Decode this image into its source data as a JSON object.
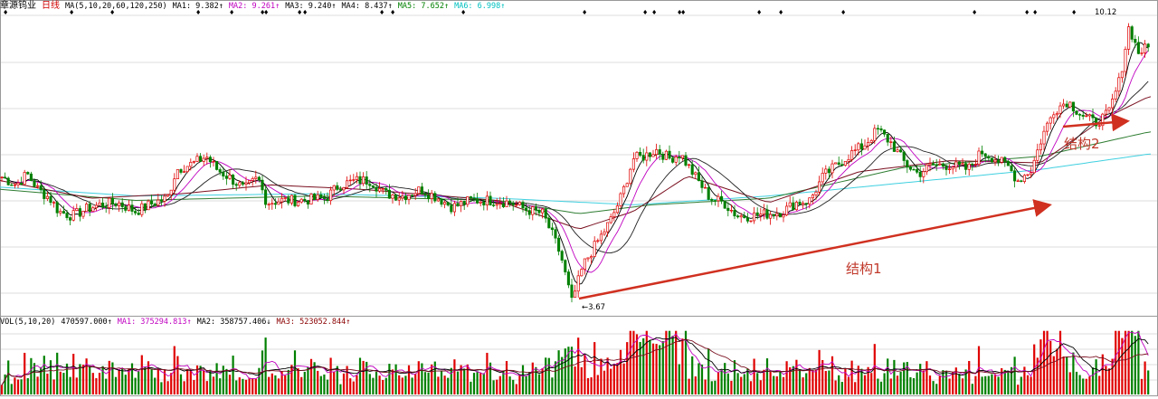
{
  "stock": {
    "name": "章源钨业",
    "period": "日线"
  },
  "price_legend": [
    {
      "text": "MA(5,10,20,60,120,250)",
      "color": "#000000"
    },
    {
      "text": "MA1: 9.382↑",
      "color": "#000000"
    },
    {
      "text": "MA2: 9.261↑",
      "color": "#c000c0"
    },
    {
      "text": "MA3: 9.240↑",
      "color": "#000000"
    },
    {
      "text": "MA4: 8.437↑",
      "color": "#000000"
    },
    {
      "text": "MA5: 7.652↑",
      "color": "#008000"
    },
    {
      "text": "MA6: 6.998↑",
      "color": "#00c0c0"
    }
  ],
  "volume_legend": [
    {
      "text": "VOL(5,10,20)",
      "color": "#000000"
    },
    {
      "text": "470597.000↑",
      "color": "#000000"
    },
    {
      "text": "MA1: 375294.813↑",
      "color": "#c000c0"
    },
    {
      "text": "MA2: 358757.406↓",
      "color": "#000000"
    },
    {
      "text": "MA3: 523052.844↑",
      "color": "#8b0000"
    }
  ],
  "annotations": {
    "structure1": "结构1",
    "structure2": "结构2",
    "high_label": "10.12",
    "low_label": "3.67"
  },
  "colors": {
    "up": "#e00000",
    "down": "#008000",
    "arrow": "#d03020",
    "grid": "#dcdcdc",
    "ma1": "#000000",
    "ma2": "#c000c0",
    "ma3": "#202020",
    "ma4": "#7a1020",
    "ma5": "#2e7d32",
    "ma6": "#40d0e0"
  },
  "chart_data": {
    "type": "candlestick",
    "y_range": [
      3.5,
      10.3
    ],
    "low_value": 3.67,
    "high_value": 10.12,
    "ma_latest": {
      "MA1": 9.382,
      "MA2": 9.261,
      "MA3": 9.24,
      "MA4": 8.437,
      "MA5": 7.652,
      "MA6": 6.998
    },
    "close_path": [
      [
        0,
        6.6
      ],
      [
        18,
        6.4
      ],
      [
        30,
        6.65
      ],
      [
        42,
        6.3
      ],
      [
        55,
        6.1
      ],
      [
        65,
        5.8
      ],
      [
        80,
        5.7
      ],
      [
        95,
        5.85
      ],
      [
        110,
        5.95
      ],
      [
        130,
        6.0
      ],
      [
        150,
        5.8
      ],
      [
        170,
        6.0
      ],
      [
        185,
        6.1
      ],
      [
        195,
        6.75
      ],
      [
        215,
        6.9
      ],
      [
        228,
        7.05
      ],
      [
        240,
        6.75
      ],
      [
        255,
        6.55
      ],
      [
        270,
        6.3
      ],
      [
        285,
        6.55
      ],
      [
        295,
        6.0
      ],
      [
        310,
        6.05
      ],
      [
        330,
        6.05
      ],
      [
        360,
        6.1
      ],
      [
        375,
        6.4
      ],
      [
        395,
        6.5
      ],
      [
        410,
        6.5
      ],
      [
        425,
        6.2
      ],
      [
        445,
        6.15
      ],
      [
        465,
        6.3
      ],
      [
        485,
        6.1
      ],
      [
        500,
        5.9
      ],
      [
        520,
        6.05
      ],
      [
        545,
        6.05
      ],
      [
        565,
        6.0
      ],
      [
        580,
        5.85
      ],
      [
        600,
        5.75
      ],
      [
        612,
        5.2
      ],
      [
        620,
        4.8
      ],
      [
        632,
        3.75
      ],
      [
        645,
        4.6
      ],
      [
        660,
        5.1
      ],
      [
        675,
        5.6
      ],
      [
        688,
        6.2
      ],
      [
        700,
        7.0
      ],
      [
        712,
        7.05
      ],
      [
        725,
        7.2
      ],
      [
        740,
        7.0
      ],
      [
        752,
        7.1
      ],
      [
        768,
        6.6
      ],
      [
        785,
        6.1
      ],
      [
        800,
        6.0
      ],
      [
        815,
        5.7
      ],
      [
        830,
        5.7
      ],
      [
        850,
        5.75
      ],
      [
        865,
        5.8
      ],
      [
        880,
        6.0
      ],
      [
        895,
        6.05
      ],
      [
        910,
        6.6
      ],
      [
        925,
        6.85
      ],
      [
        940,
        7.1
      ],
      [
        955,
        7.3
      ],
      [
        970,
        7.65
      ],
      [
        985,
        7.35
      ],
      [
        1000,
        6.9
      ],
      [
        1015,
        6.65
      ],
      [
        1030,
        6.85
      ],
      [
        1050,
        6.85
      ],
      [
        1070,
        6.75
      ],
      [
        1085,
        7.15
      ],
      [
        1100,
        7.0
      ],
      [
        1115,
        6.8
      ],
      [
        1125,
        6.5
      ],
      [
        1140,
        6.75
      ],
      [
        1152,
        7.5
      ],
      [
        1165,
        8.1
      ],
      [
        1180,
        8.3
      ],
      [
        1195,
        8.0
      ],
      [
        1210,
        7.8
      ],
      [
        1225,
        8.0
      ],
      [
        1238,
        8.8
      ],
      [
        1248,
        10.0
      ],
      [
        1258,
        9.4
      ],
      [
        1268,
        9.5
      ]
    ],
    "ma_paths": {
      "MA6": [
        [
          0,
          6.35
        ],
        [
          150,
          6.15
        ],
        [
          350,
          6.2
        ],
        [
          550,
          6.1
        ],
        [
          700,
          5.95
        ],
        [
          850,
          6.15
        ],
        [
          1000,
          6.45
        ],
        [
          1150,
          6.75
        ],
        [
          1270,
          7.1
        ]
      ],
      "MA5": [
        [
          0,
          6.3
        ],
        [
          150,
          6.05
        ],
        [
          350,
          6.15
        ],
        [
          550,
          6.05
        ],
        [
          640,
          5.75
        ],
        [
          720,
          5.95
        ],
        [
          850,
          6.1
        ],
        [
          1000,
          6.8
        ],
        [
          1150,
          7.05
        ],
        [
          1270,
          7.6
        ]
      ],
      "MA4": [
        [
          0,
          6.5
        ],
        [
          100,
          6.1
        ],
        [
          200,
          6.2
        ],
        [
          300,
          6.4
        ],
        [
          400,
          6.3
        ],
        [
          550,
          6.05
        ],
        [
          640,
          5.4
        ],
        [
          700,
          5.8
        ],
        [
          760,
          6.6
        ],
        [
          850,
          6.0
        ],
        [
          950,
          6.7
        ],
        [
          1050,
          6.95
        ],
        [
          1150,
          6.9
        ],
        [
          1220,
          7.9
        ],
        [
          1270,
          8.4
        ]
      ]
    },
    "volume_range": [
      0,
      1300000
    ],
    "volume_last": 470597.0
  }
}
